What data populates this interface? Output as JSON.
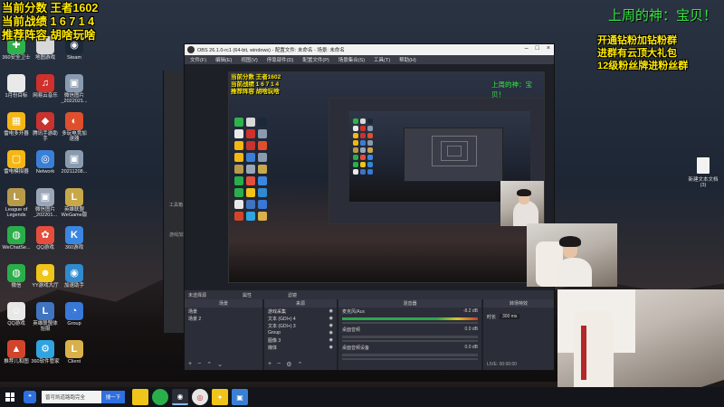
{
  "overlay": {
    "top_left": [
      "当前分数 王者1602",
      "当前战绩 1 6 7 1 4",
      "推荐阵容 胡啥玩啥"
    ],
    "top_right": "上周的神：宝贝！",
    "right_promo": [
      "开通钻粉加钻粉群",
      "进群有云顶大礼包",
      "12级粉丝牌进粉丝群"
    ]
  },
  "desktop_icons": [
    {
      "label": "360安全卫士",
      "icon": "shield-icon",
      "color": "#2fb24b",
      "glyph": "✚"
    },
    {
      "label": "地图游戏",
      "icon": "file-icon",
      "color": "#d8d8d8",
      "glyph": ""
    },
    {
      "label": "Steam",
      "icon": "steam-icon",
      "color": "#1b2838",
      "glyph": "◉"
    },
    {
      "label": "1月份目标",
      "icon": "doc-icon",
      "color": "#e9e9e9",
      "glyph": ""
    },
    {
      "label": "网易云音乐",
      "icon": "music-icon",
      "color": "#d0302b",
      "glyph": "♫"
    },
    {
      "label": "微信图片_2022021...",
      "icon": "image-icon",
      "color": "#8a9bb0",
      "glyph": "▣"
    },
    {
      "label": "雷电多开器",
      "icon": "emulator-icon",
      "color": "#f5b614",
      "glyph": "▦"
    },
    {
      "label": "腾讯手游助手",
      "icon": "game-icon",
      "color": "#c8332e",
      "glyph": "◆"
    },
    {
      "label": "多玩电竞加速器",
      "icon": "accelerator-icon",
      "color": "#e04f2b",
      "glyph": "◐"
    },
    {
      "label": "雷电模拟器",
      "icon": "emulator-icon",
      "color": "#f5b614",
      "glyph": "▢"
    },
    {
      "label": "Network",
      "icon": "network-icon",
      "color": "#3a7fd6",
      "glyph": "◎"
    },
    {
      "label": "20211208...",
      "icon": "image-icon",
      "color": "#8a9bb0",
      "glyph": "▣"
    },
    {
      "label": "League of Legends",
      "icon": "lol-icon",
      "color": "#b89a4a",
      "glyph": "L"
    },
    {
      "label": "微信图片_202201...",
      "icon": "image-icon",
      "color": "#9aa6b8",
      "glyph": "▣"
    },
    {
      "label": "英雄联盟WeGame版",
      "icon": "lol-wegame-icon",
      "color": "#c9a84a",
      "glyph": "L"
    },
    {
      "label": "WeChatSe...",
      "icon": "wechat-icon",
      "color": "#2aae4a",
      "glyph": "◍"
    },
    {
      "label": "QQ游戏",
      "icon": "qqgame-icon",
      "color": "#e54e3d",
      "glyph": "✿"
    },
    {
      "label": "360游戏",
      "icon": "game360-icon",
      "color": "#3a86e0",
      "glyph": "K"
    },
    {
      "label": "微信",
      "icon": "wechat-icon",
      "color": "#2aae4a",
      "glyph": "◍"
    },
    {
      "label": "YY游戏大厅",
      "icon": "yy-icon",
      "color": "#f0c419",
      "glyph": "☻"
    },
    {
      "label": "加速助手",
      "icon": "assist-icon",
      "color": "#2f8ad0",
      "glyph": "◉"
    },
    {
      "label": "QQ游戏",
      "icon": "qq-icon",
      "color": "#e8e8e8",
      "glyph": "☺"
    },
    {
      "label": "英雄联盟体验服",
      "icon": "lol-pbe-icon",
      "color": "#3f74c2",
      "glyph": "L"
    },
    {
      "label": "Group",
      "icon": "group-icon",
      "color": "#3878d8",
      "glyph": "◔"
    },
    {
      "label": "推荐儿和图",
      "icon": "game-icon",
      "color": "#d2452b",
      "glyph": "▲"
    },
    {
      "label": "360软件管家",
      "icon": "manager-icon",
      "color": "#2fa4e0",
      "glyph": "⚙"
    },
    {
      "label": "Client",
      "icon": "client-icon",
      "color": "#d9b14a",
      "glyph": "L"
    }
  ],
  "right_file": "新建文本文档(3)",
  "bg_window": {
    "labels": [
      "工具箱",
      "游戏加速"
    ]
  },
  "obs": {
    "title": "OBS 26.1.0-rc1 (64-bit, windows) - 配置文件: 未命名 - 场景: 未命名",
    "menu": [
      "文件(F)",
      "编辑(E)",
      "视图(V)",
      "停靠部件(D)",
      "配置文件(P)",
      "场景集合(S)",
      "工具(T)",
      "帮助(H)"
    ],
    "status_left": "未选择源",
    "status_props": "属性",
    "status_filters": "滤镜",
    "scenes_title": "场景",
    "scenes": [
      "场景",
      "场景 2"
    ],
    "sources_title": "来源",
    "sources": [
      "游戏采集",
      "文本 (GDI+) 4",
      "文本 (GDI+) 3",
      "Group",
      "图像 3",
      "媒体"
    ],
    "mixer_title": "混音器",
    "mixer": [
      {
        "name": "麦克风/Aux",
        "db": "-8.2 dB"
      },
      {
        "name": "桌面音频",
        "db": "0.0 dB"
      },
      {
        "name": "桌面音频设备",
        "db": "0.0 dB"
      }
    ],
    "transition_title": "转场特效",
    "transition_label": "时长",
    "transition_value": "300 ms",
    "control_footer": "LIVE: 00:00:00"
  },
  "taskbar": {
    "search_placeholder": "曾可凯道路跑完全",
    "search_button": "搜一下"
  }
}
